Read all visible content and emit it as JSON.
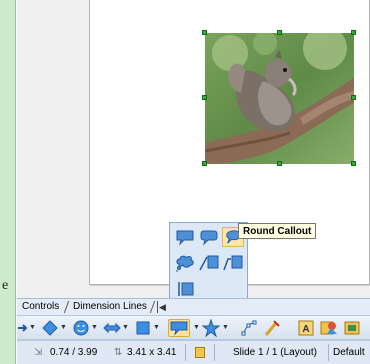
{
  "left_pane": {
    "fragment_text": "e"
  },
  "tooltip": {
    "text": "Round Callout"
  },
  "sheet_tabs": [
    {
      "label": "Controls"
    },
    {
      "label": "Dimension Lines"
    }
  ],
  "status": {
    "position": "0.74 / 3.99",
    "size": "3.41 x 3.41",
    "slide": "Slide 1 / 1 (Layout)",
    "master": "Default"
  },
  "icons": {
    "photo": "squirrel-photo",
    "popup_items": [
      "rectangular-callout-icon",
      "rounded-rectangular-callout-icon",
      "round-callout-icon",
      "cloud-callout-icon",
      "line-callout-1-icon",
      "line-callout-2-icon",
      "line-callout-3-icon"
    ],
    "toolbar": [
      "arrow-icon",
      "basic-shapes-icon",
      "symbol-shapes-icon",
      "block-arrows-icon",
      "flowchart-icon",
      "callouts-icon",
      "stars-icon",
      "points-icon",
      "glue-points-icon",
      "fontwork-icon",
      "from-file-icon",
      "gallery-icon"
    ]
  },
  "colors": {
    "selection_handle": "#2fae2f",
    "active_highlight": "#ffe39c",
    "popup_bg": "#dde8f6"
  }
}
